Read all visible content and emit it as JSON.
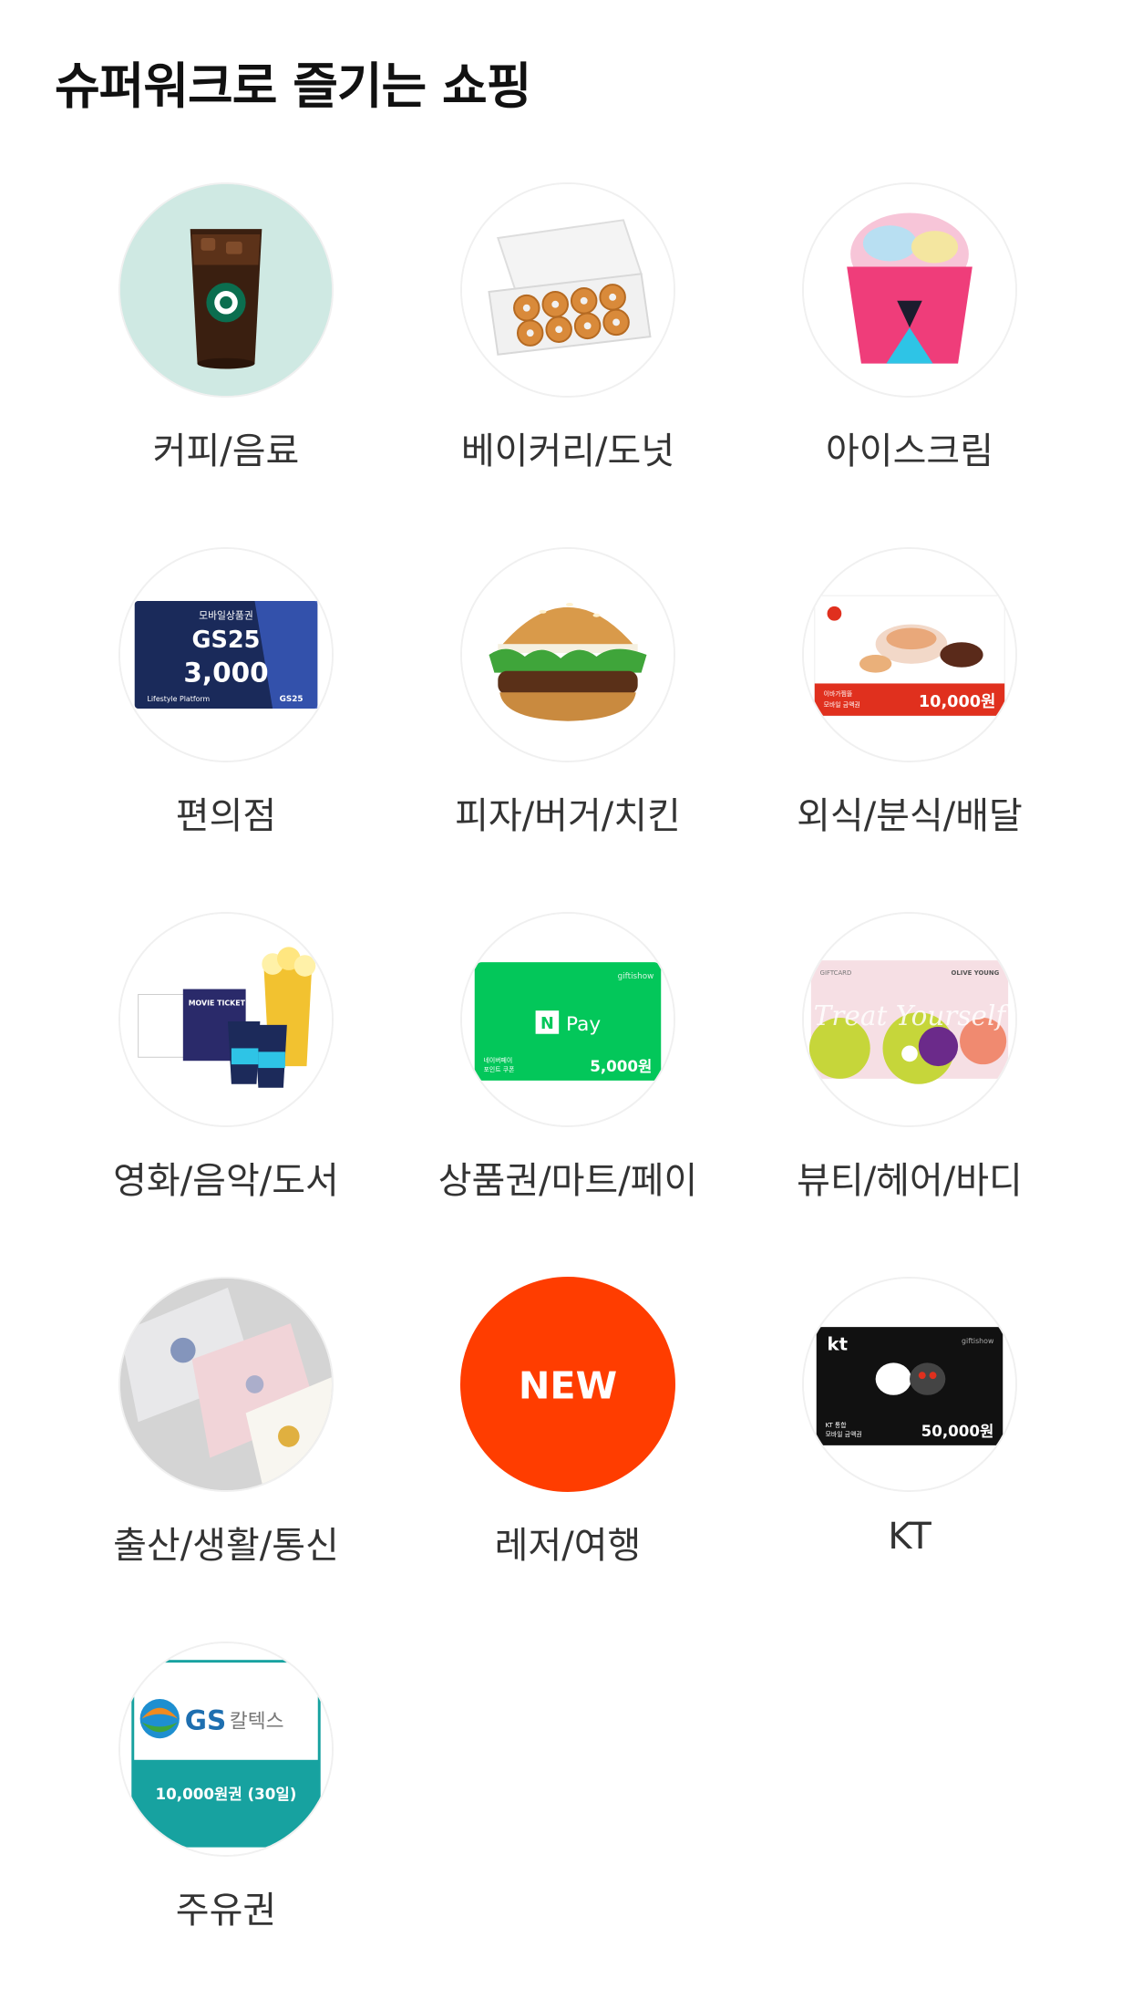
{
  "section": {
    "title": "슈퍼워크로 즐기는 쇼핑"
  },
  "categories": [
    {
      "label": "커피/음료",
      "icon": "iced-coffee-icon"
    },
    {
      "label": "베이커리/도넛",
      "icon": "donut-box-icon"
    },
    {
      "label": "아이스크림",
      "icon": "ice-cream-cup-icon"
    },
    {
      "label": "편의점",
      "icon": "gs25-gift-card-icon",
      "card": {
        "top": "모바일상품권",
        "brand": "GS25",
        "amount": "3,000",
        "footer_left": "Lifestyle Platform",
        "footer_right": "GS25"
      }
    },
    {
      "label": "피자/버거/치킨",
      "icon": "burger-icon"
    },
    {
      "label": "외식/분식/배달",
      "icon": "restaurant-voucher-icon",
      "card": {
        "line1": "이바가찜뜰",
        "line2": "모바일 금액권",
        "amount": "10,000원"
      }
    },
    {
      "label": "영화/음악/도서",
      "icon": "movie-ticket-popcorn-icon",
      "card": {
        "ticket": "MOVIE TICKET"
      }
    },
    {
      "label": "상품권/마트/페이",
      "icon": "naver-pay-card-icon",
      "card": {
        "corner": "giftishow",
        "logo": "N",
        "name": "Pay",
        "line1": "네이버페이",
        "line2": "포인트 쿠폰",
        "amount": "5,000원"
      }
    },
    {
      "label": "뷰티/헤어/바디",
      "icon": "olive-young-card-icon",
      "card": {
        "left": "GIFTCARD",
        "right": "OLIVE YOUNG",
        "script": "Treat Yourself"
      }
    },
    {
      "label": "출산/생활/통신",
      "icon": "towels-icon"
    },
    {
      "label": "레저/여행",
      "icon": "new-badge-icon",
      "card": {
        "text": "NEW"
      }
    },
    {
      "label": "KT",
      "icon": "kt-gift-card-icon",
      "card": {
        "logo": "kt",
        "corner": "giftishow",
        "line1": "KT 통합",
        "line2": "모바일 금액권",
        "amount": "50,000원"
      }
    },
    {
      "label": "주유권",
      "icon": "gs-caltex-voucher-icon",
      "card": {
        "brand": "GS",
        "name": "칼텍스",
        "amount": "10,000원권 (30일)"
      }
    }
  ],
  "colors": {
    "accent_new": "#ff3d00",
    "naver_green": "#03c75a",
    "gs_caltex_teal": "#17a2a0",
    "gs25_navy": "#1a2a5a"
  }
}
